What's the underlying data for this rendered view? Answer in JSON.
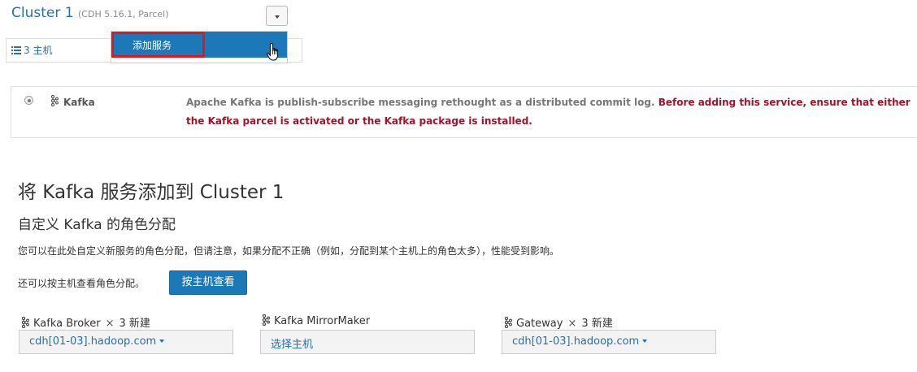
{
  "cluster": {
    "title": "Cluster 1",
    "meta": "(CDH 5.16.1, Parcel)"
  },
  "hosts_tab": {
    "label": "3 主机"
  },
  "dropdown": {
    "add_service_label": "添加服务"
  },
  "service": {
    "name": "Kafka",
    "description_plain": "Apache Kafka is publish-subscribe messaging rethought as a distributed commit log. ",
    "description_warning": "Before adding this service, ensure that either the Kafka parcel is activated or the Kafka package is installed."
  },
  "wizard": {
    "title": "将 Kafka 服务添加到 Cluster 1",
    "subtitle": "自定义 Kafka 的角色分配",
    "description": "您可以在此处自定义新服务的角色分配，但请注意，如果分配不正确（例如，分配到某个主机上的角色太多），性能受到影响。",
    "alt_text": "还可以按主机查看角色分配。",
    "view_by_host_button": "按主机查看"
  },
  "roles": [
    {
      "name": "Kafka Broker",
      "times": "×",
      "count": "3 新建",
      "host": "cdh[01-03].hadoop.com"
    },
    {
      "name": "Kafka MirrorMaker",
      "times": "",
      "count": "",
      "host": "选择主机"
    },
    {
      "name": "Gateway",
      "times": "×",
      "count": "3 新建",
      "host": "cdh[01-03].hadoop.com"
    }
  ],
  "colors": {
    "link": "#2a6ead",
    "primary": "#1c78b6",
    "warning": "#a3122a",
    "highlight": "#e8141b"
  }
}
